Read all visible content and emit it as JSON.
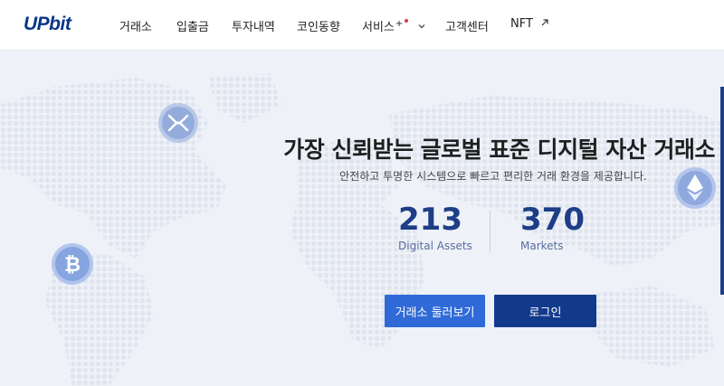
{
  "brand": {
    "logo_text": "UPbit",
    "accent": "#093687"
  },
  "nav": {
    "items": [
      {
        "label": "거래소"
      },
      {
        "label": "입출금"
      },
      {
        "label": "투자내역"
      },
      {
        "label": "코인동향"
      },
      {
        "label": "서비스"
      },
      {
        "label": "고객센터"
      },
      {
        "label": "NFT"
      }
    ],
    "service_plus": "+"
  },
  "hero": {
    "headline": "가장 신뢰받는 글로벌 표준 디지털 자산 거래소",
    "subline": "안전하고 투명한 시스템으로 빠르고 편리한 거래 환경을 제공합니다.",
    "stats": [
      {
        "value": "213",
        "label": "Digital Assets"
      },
      {
        "value": "370",
        "label": "Markets"
      }
    ],
    "buttons": {
      "explore": "거래소 둘러보기",
      "login": "로그인"
    },
    "colors": {
      "primary_button": "#2f6ad8",
      "secondary_button": "#123a8c",
      "stat_number": "#1d3e87"
    },
    "coins": [
      "xrp-icon",
      "bitcoin-icon",
      "ethereum-icon"
    ]
  }
}
